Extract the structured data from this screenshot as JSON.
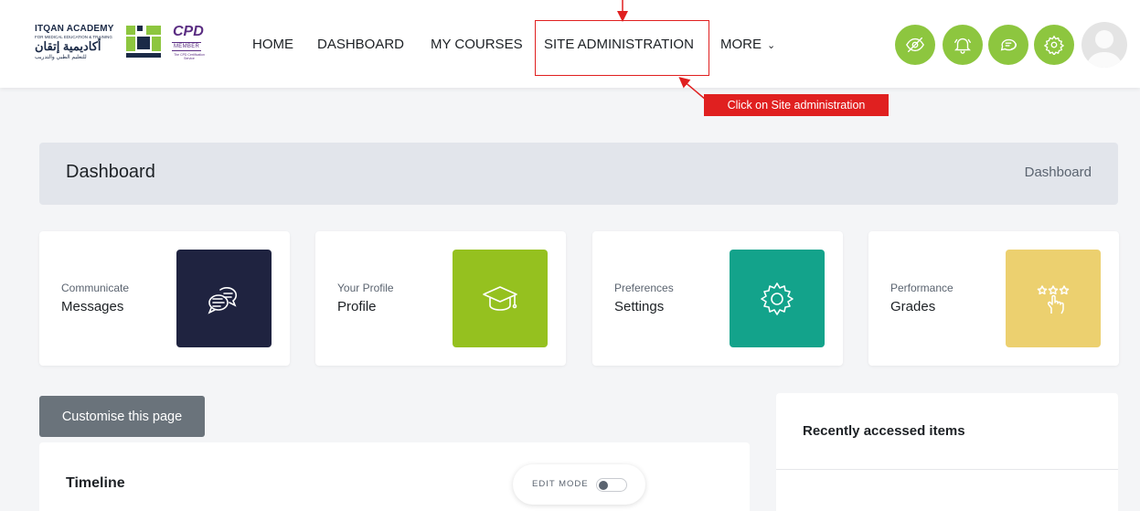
{
  "logo": {
    "title": "ITQAN ACADEMY",
    "subtitle": "FOR MEDICAL EDUCATION & TRAINING",
    "arabic": "أكاديمية إتقان",
    "arabic_sub": "للتعليم الطبي والتدريب",
    "brand_tag": "ITQAN",
    "cpd": "CPD",
    "cpd_member": "MEMBER",
    "cpd_service": "The CPD Certification Service"
  },
  "nav": {
    "home": "HOME",
    "dashboard": "DASHBOARD",
    "my_courses": "MY COURSES",
    "site_admin": "SITE ADMINISTRATION",
    "more": "MORE"
  },
  "annotation": {
    "callout": "Click on Site administration",
    "color": "#e02020"
  },
  "header_icons": [
    "eye-slash-icon",
    "bell-icon",
    "chat-icon",
    "gear-icon"
  ],
  "colors": {
    "accent": "#8dc63f",
    "messages_tile": "#1f2340",
    "profile_tile": "#95c11f",
    "settings_tile": "#13a38b",
    "grades_tile": "#ecd06f"
  },
  "page": {
    "title": "Dashboard",
    "breadcrumb": "Dashboard"
  },
  "cards": [
    {
      "kicker": "Communicate",
      "label": "Messages",
      "icon": "messages-icon"
    },
    {
      "kicker": "Your Profile",
      "label": "Profile",
      "icon": "graduation-cap-icon"
    },
    {
      "kicker": "Preferences",
      "label": "Settings",
      "icon": "gear-icon"
    },
    {
      "kicker": "Performance",
      "label": "Grades",
      "icon": "stars-hand-icon"
    }
  ],
  "customise_label": "Customise this page",
  "timeline": {
    "title": "Timeline",
    "edit_mode_label": "EDIT MODE",
    "edit_mode_on": false
  },
  "recent": {
    "title": "Recently accessed items"
  }
}
